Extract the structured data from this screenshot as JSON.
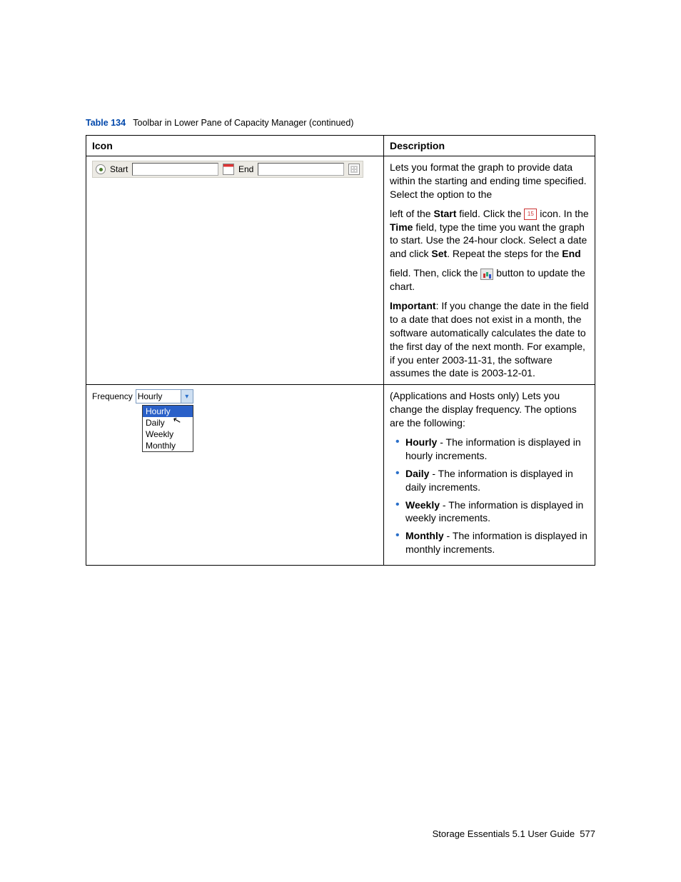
{
  "caption": {
    "label": "Table 134",
    "title": "Toolbar in Lower Pane of Capacity Manager (continued)"
  },
  "headers": {
    "icon": "Icon",
    "desc": "Description"
  },
  "row1": {
    "toolbar": {
      "start": "Start",
      "end": "End"
    },
    "p1": "Lets you format the graph to provide data within the starting and ending time specified. Select the option to the",
    "p2a": "left of the ",
    "p2b_bold": "Start",
    "p2c": " field. Click the ",
    "p2d_icon_name": "calendar-15-icon",
    "p2e": " icon. In the ",
    "p2f_bold": "Time",
    "p2g": " field, type the time you want the graph to start. Use the 24-hour clock. Select a date and click ",
    "p2h_bold": "Set",
    "p2i": ". Repeat the steps for the ",
    "p2j_bold": "End",
    "p3a": "field. Then, click the ",
    "p3b_icon_name": "chart-update-icon",
    "p3c": " button to update the chart.",
    "p4a_bold": "Important",
    "p4b": ": If you change the date in the field to a date that does not exist in a month, the software automatically calculates the date to the first day of the next month. For example, if you enter 2003-11-31, the software assumes the date is 2003-12-01."
  },
  "row2": {
    "freq_label": "Frequency",
    "freq_value": "Hourly",
    "options": [
      "Hourly",
      "Daily",
      "Weekly",
      "Monthly"
    ],
    "intro": "(Applications and Hosts only) Lets you change the display frequency. The options are the following:",
    "items": [
      {
        "b": "Hourly",
        "t": " - The information is displayed in hourly increments."
      },
      {
        "b": "Daily",
        "t": " - The information is displayed in daily increments."
      },
      {
        "b": "Weekly",
        "t": " - The information is displayed in weekly increments."
      },
      {
        "b": "Monthly",
        "t": " - The information is displayed in monthly increments."
      }
    ]
  },
  "footer": {
    "text": "Storage Essentials 5.1 User Guide",
    "page": "577"
  }
}
